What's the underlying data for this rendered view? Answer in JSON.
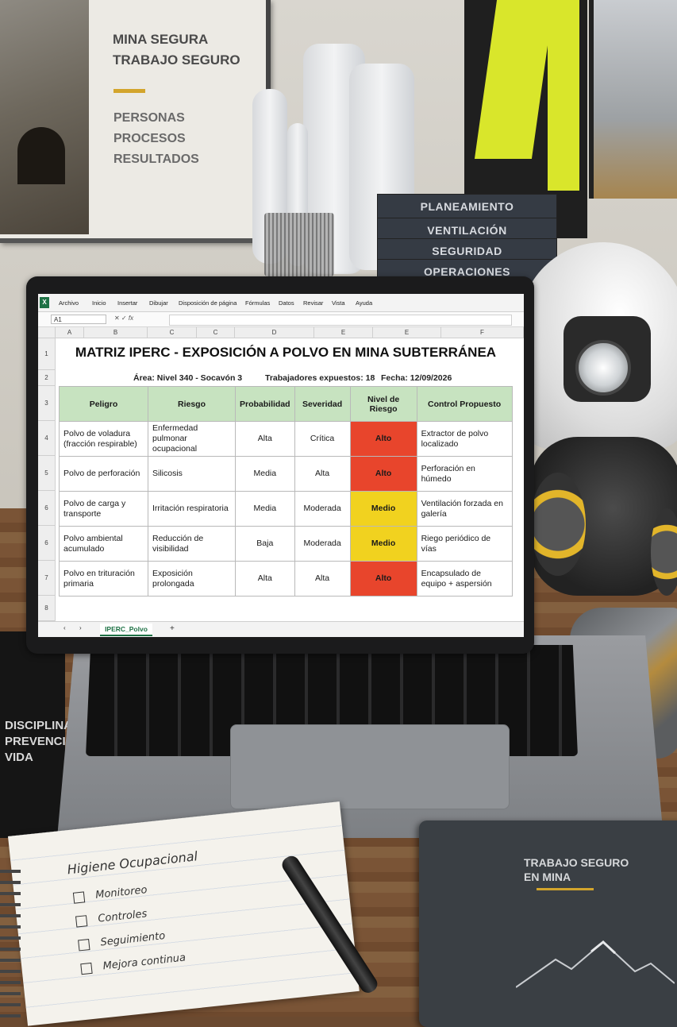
{
  "poster": {
    "title_line1": "MINA SEGURA",
    "title_line2": "TRABAJO SEGURO",
    "items": [
      "PERSONAS",
      "PROCESOS",
      "RESULTADOS"
    ]
  },
  "binders": [
    "PLANEAMIENTO",
    "VENTILACIÓN",
    "SEGURIDAD",
    "OPERACIONES"
  ],
  "mug": [
    "DISCIPLINA",
    "PREVENCIÓN",
    "VIDA"
  ],
  "spreadsheet": {
    "ribbon_tabs": [
      "Archivo",
      "Inicio",
      "Insertar",
      "Dibujar",
      "Disposición de página",
      "Fórmulas",
      "Datos",
      "Revisar",
      "Vista",
      "Ayuda"
    ],
    "name_box": "A1",
    "fx_label": "fx",
    "columns": [
      "A",
      "B",
      "C",
      "C",
      "D",
      "E",
      "E",
      "F"
    ],
    "rows": [
      "1",
      "2",
      "3",
      "4",
      "5",
      "6",
      "6",
      "7",
      "8"
    ],
    "title": "MATRIZ IPERC - EXPOSICIÓN A POLVO EN MINA SUBTERRÁNEA",
    "area": "Área: Nivel 340 - Socavón 3",
    "workers": "Trabajadores expuestos: 18",
    "date": "Fecha: 12/09/2026",
    "headers": [
      "Peligro",
      "Riesgo",
      "Probabilidad",
      "Severidad",
      "Nivel de Riesgo",
      "Control Propuesto"
    ],
    "table": [
      [
        "Polvo de voladura (fracción respirable)",
        "Enfermedad pulmonar ocupacional",
        "Alta",
        "Crítica",
        "Alto",
        "Extractor de polvo localizado"
      ],
      [
        "Polvo de perforación",
        "Silicosis",
        "Media",
        "Alta",
        "Alto",
        "Perforación en húmedo"
      ],
      [
        "Polvo de carga y transporte",
        "Irritación respiratoria",
        "Media",
        "Moderada",
        "Medio",
        "Ventilación forzada en galería"
      ],
      [
        "Polvo ambiental acumulado",
        "Reducción de visibilidad",
        "Baja",
        "Moderada",
        "Medio",
        "Riego periódico de vías"
      ],
      [
        "Polvo en trituración primaria",
        "Exposición prolongada",
        "Alta",
        "Alta",
        "Alto",
        "Encapsulado de equipo + aspersión"
      ]
    ],
    "risk_colors": {
      "Alto": "#e8452c",
      "Medio": "#f1d21f"
    },
    "header_color": "#c7e3c0",
    "sheet_tab": "IPERC_Polvo",
    "add_sheet": "+"
  },
  "notebook": {
    "title": "Higiene Ocupacional",
    "items": [
      "Monitoreo",
      "Controles",
      "Seguimiento",
      "Mejora continua"
    ]
  },
  "book": {
    "title_line1": "TRABAJO SEGURO",
    "title_line2": "EN MINA"
  },
  "icons": [
    "check-icon",
    "mountain-icon",
    "add-sheet-icon",
    "nav-prev-icon",
    "nav-next-icon"
  ]
}
